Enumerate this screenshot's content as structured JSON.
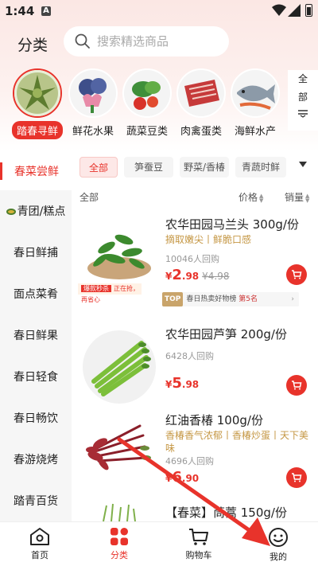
{
  "status_bar": {
    "time": "1:44",
    "notif_letter": "A"
  },
  "header": {
    "title": "分类",
    "search_placeholder": "搜索精选商品"
  },
  "top_categories": [
    {
      "label": "踏春寻鲜",
      "active": true
    },
    {
      "label": "鲜花水果",
      "active": false
    },
    {
      "label": "蔬菜豆类",
      "active": false
    },
    {
      "label": "肉禽蛋类",
      "active": false
    },
    {
      "label": "海鲜水产",
      "active": false
    }
  ],
  "all_button": {
    "label_1": "全",
    "label_2": "部"
  },
  "sub_category_selected": "春菜尝鲜",
  "chips": [
    {
      "label": "全部",
      "active": true
    },
    {
      "label": "笋蚕豆",
      "active": false
    },
    {
      "label": "野菜/香椿",
      "active": false
    },
    {
      "label": "青蔬时鲜",
      "active": false
    }
  ],
  "sidebar": [
    {
      "label": "青团/糕点"
    },
    {
      "label": "春日鲜捕"
    },
    {
      "label": "面点菜肴"
    },
    {
      "label": "春日鲜果"
    },
    {
      "label": "春日轻食"
    },
    {
      "label": "春日畅饮"
    },
    {
      "label": "春游烧烤"
    },
    {
      "label": "踏青百货"
    }
  ],
  "sort_bar": {
    "all": "全部",
    "price": "价格",
    "sales": "销量"
  },
  "products": [
    {
      "name": "农华田园马兰头 300g/份",
      "desc": "摘取嫩尖丨鲜脆口感",
      "buyers": "10046人回购",
      "price_symbol": "¥",
      "price_int": "2",
      "price_dec": ".98",
      "price_orig": "¥4.98",
      "promo_tag": "爆款秒杀",
      "promo_text": "正在抢，再省心",
      "rank_badge": "TOP",
      "rank_text": "春日热卖好物榜",
      "rank_pos": "第5名"
    },
    {
      "name": "农华田园芦笋 200g/份",
      "desc": "",
      "buyers": "6428人回购",
      "price_symbol": "¥",
      "price_int": "5",
      "price_dec": ".98"
    },
    {
      "name": "红油香椿 100g/份",
      "desc": "香椿香气浓郁丨香椿炒蛋丨天下美味",
      "buyers": "4696人回购",
      "price_symbol": "¥",
      "price_int": "6",
      "price_dec": ".90"
    },
    {
      "name": "【春菜】茼蒿 150g/份"
    }
  ],
  "bottom_nav": [
    {
      "label": "首页",
      "active": false
    },
    {
      "label": "分类",
      "active": true
    },
    {
      "label": "购物车",
      "active": false
    },
    {
      "label": "我的",
      "active": false
    }
  ],
  "colors": {
    "accent": "#e8332b",
    "gold": "#c59744",
    "annotation_arrow": "#e8332b"
  }
}
